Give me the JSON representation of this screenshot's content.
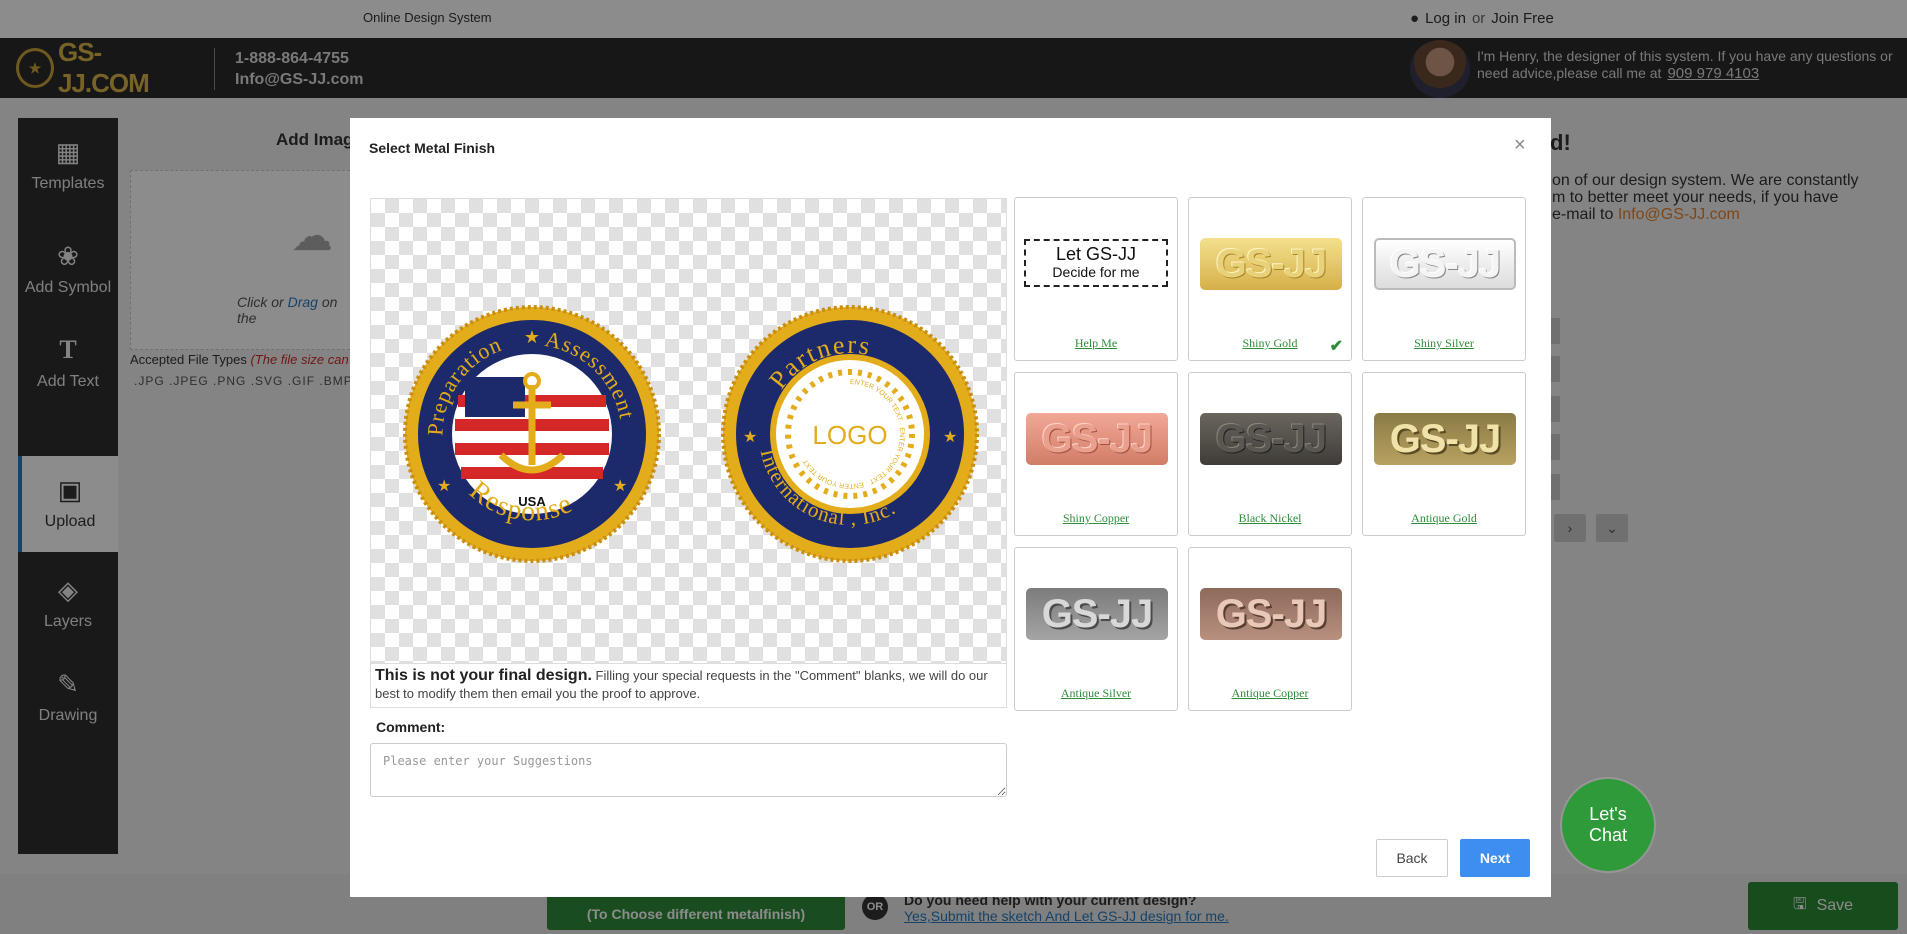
{
  "topbar": {
    "system_name": "Online Design System",
    "login": "Log in",
    "or": "or",
    "join": "Join Free"
  },
  "header": {
    "logo_text": "GS-JJ.COM",
    "phone": "1-888-864-4755",
    "email": "Info@GS-JJ.com",
    "designer_msg": "I'm Henry, the designer of this system. If you have any questions or need advice,please call me at",
    "designer_phone": "909 979 4103"
  },
  "sidebar": {
    "items": [
      {
        "label": "Templates",
        "icon": "grid-icon"
      },
      {
        "label": "Add Symbol",
        "icon": "symbol-icon"
      },
      {
        "label": "Add Text",
        "icon": "text-icon"
      },
      {
        "label": "Upload",
        "icon": "image-icon"
      },
      {
        "label": "Layers",
        "icon": "layers-icon"
      },
      {
        "label": "Drawing",
        "icon": "drawing-icon"
      }
    ]
  },
  "upload_panel": {
    "title": "Add Imag",
    "hint_click": "Click",
    "hint_or": "or",
    "hint_drag": "Drag",
    "hint_rest": "on the",
    "accepted_label": "Accepted File Types",
    "accepted_note": "(The file size can",
    "file_types": ".JPG  .JPEG  .PNG  .SVG  .GIF  .BMP  .P"
  },
  "right_panel": {
    "heading": "d!",
    "line1": "on of our design system. We are constantly",
    "line2": "m to better meet your needs, if you have",
    "line3_prefix": "e-mail to",
    "email": "Info@GS-JJ.com"
  },
  "bottom": {
    "next_sub": "(To Choose different metalfinish)",
    "or": "OR",
    "help_question": "Do you need help with your current design?",
    "help_link": "Yes,Submit the sketch And Let GS-JJ design for me.",
    "save": "Save"
  },
  "modal": {
    "title": "Select Metal Finish",
    "close": "×",
    "coin1": {
      "top_left": "Preparation",
      "top_right": "Assessment",
      "bottom": "Response",
      "flag": "USA"
    },
    "coin2": {
      "top": "Partners",
      "bottom": "International , Inc.",
      "center": "LOGO",
      "ring": "ENTER YOUR TEXT · ENTER YOUR TEXT · ENTER YOUR TEXT"
    },
    "note_bold": "This is not your final design.",
    "note_text": " Filling your special requests in the \"Comment\" blanks, we will do our best to modify them then email you the proof to approve.",
    "comment_label": "Comment:",
    "comment_placeholder": "Please enter your Suggestions",
    "finishes": [
      {
        "label": "Help Me",
        "selected": false,
        "color": "#ffffff"
      },
      {
        "label": "Shiny Gold",
        "selected": true,
        "color": "#e3c76a"
      },
      {
        "label": "Shiny Silver",
        "selected": false,
        "color": "#e8e8e8"
      },
      {
        "label": "Shiny Copper",
        "selected": false,
        "color": "#e39580"
      },
      {
        "label": "Black Nickel",
        "selected": false,
        "color": "#55524c"
      },
      {
        "label": "Antique Gold",
        "selected": false,
        "color": "#c8b270"
      },
      {
        "label": "Antique Silver",
        "selected": false,
        "color": "#a8a8a8"
      },
      {
        "label": "Antique Copper",
        "selected": false,
        "color": "#b88c78"
      }
    ],
    "helpme_line1": "Let GS-JJ",
    "helpme_line2": "Decide for me",
    "plate_text": "GS-JJ",
    "back": "Back",
    "next": "Next"
  },
  "chat": {
    "line1": "Let's",
    "line2": "Chat"
  }
}
